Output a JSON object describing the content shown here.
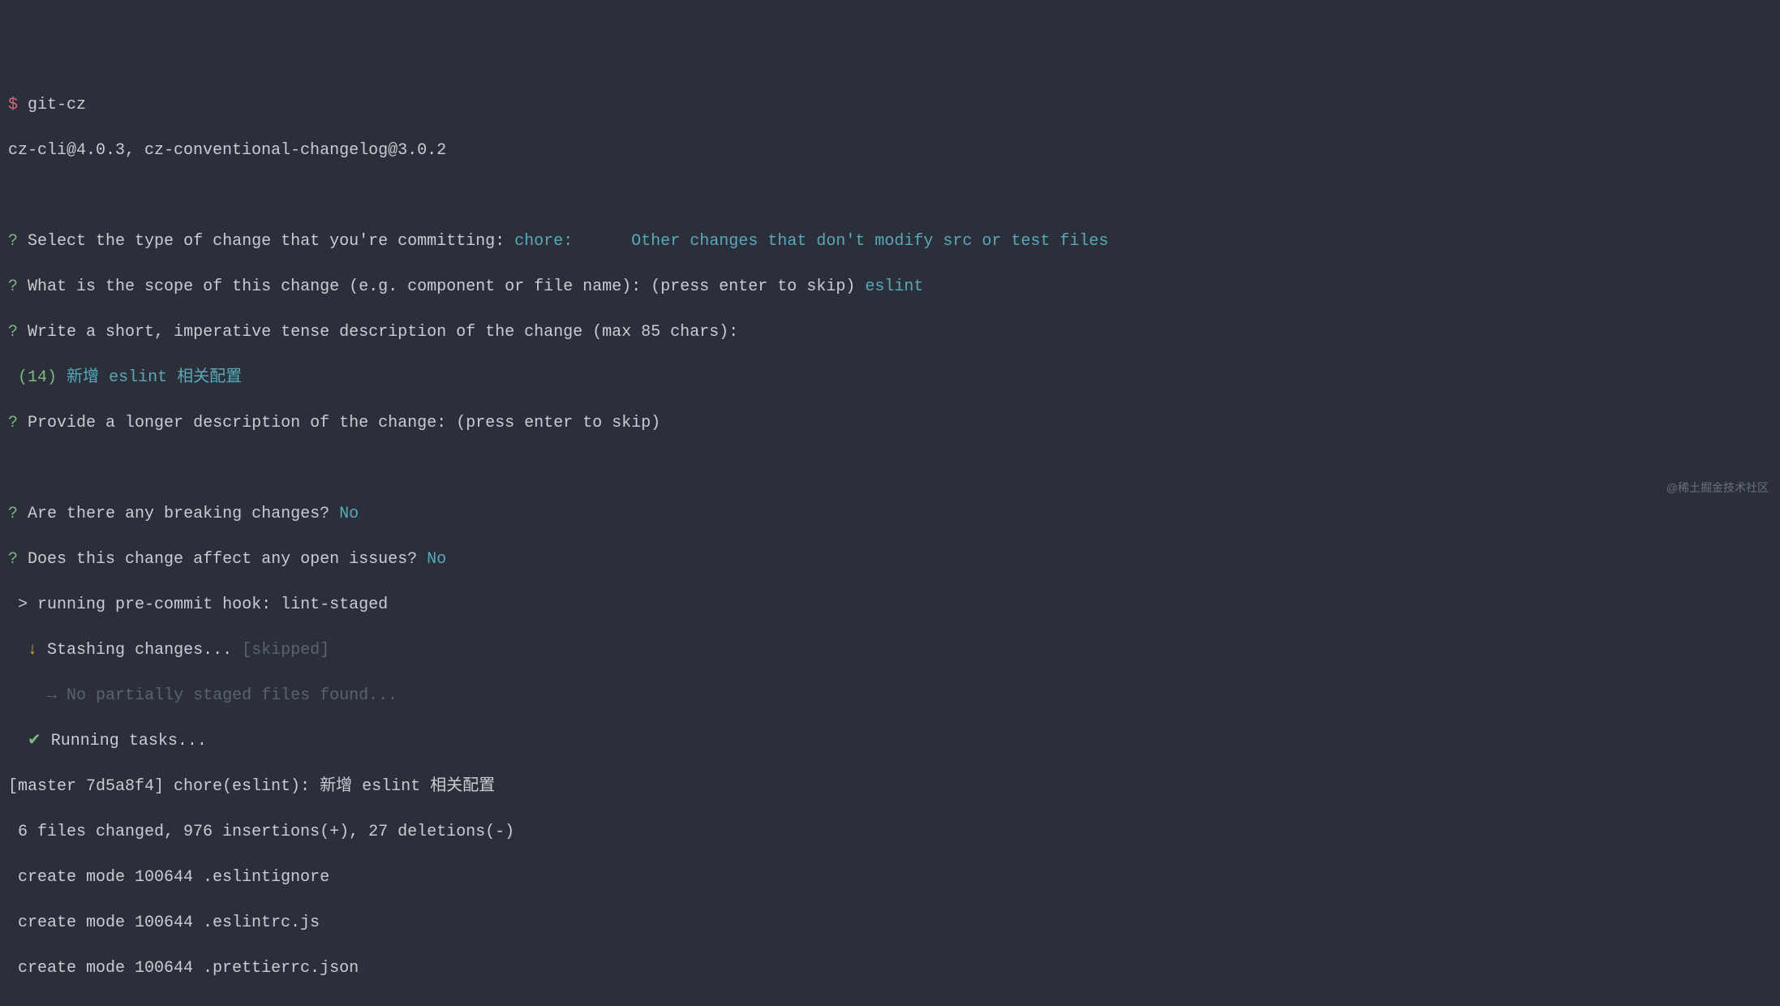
{
  "prompt": {
    "dollar": "$",
    "command": "git-cz"
  },
  "version": "cz-cli@4.0.3, cz-conventional-changelog@3.0.2",
  "q1": {
    "mark": "?",
    "text": "Select the type of change that you're committing:",
    "answer": "chore:      Other changes that don't modify src or test files"
  },
  "q2": {
    "mark": "?",
    "text": "What is the scope of this change (e.g. component or file name): (press enter to skip)",
    "answer": "eslint"
  },
  "q3": {
    "mark": "?",
    "text": "Write a short, imperative tense description of the change (max 85 chars):"
  },
  "desc": {
    "count": "(14)",
    "cjk1": "新增",
    "word": "eslint",
    "cjk2": "相关配置"
  },
  "q4": {
    "mark": "?",
    "text": "Provide a longer description of the change: (press enter to skip)"
  },
  "q5": {
    "mark": "?",
    "text": "Are there any breaking changes?",
    "answer": "No"
  },
  "q6": {
    "mark": "?",
    "text": "Does this change affect any open issues?",
    "answer": "No"
  },
  "hook": {
    "prefix": " >",
    "text": "running pre-commit hook: lint-staged"
  },
  "stash": {
    "arrow": "↓",
    "text": "Stashing changes...",
    "status": "[skipped]"
  },
  "partial": {
    "arrow": "→",
    "text": "No partially staged files found..."
  },
  "tasks": {
    "check": "✔",
    "text": "Running tasks..."
  },
  "commit": {
    "header": "[master 7d5a8f4] chore(eslint): 新增 eslint 相关配置",
    "stats": " 6 files changed, 976 insertions(+), 27 deletions(-)",
    "file1": " create mode 100644 .eslintignore",
    "file2": " create mode 100644 .eslintrc.js",
    "file3": " create mode 100644 .prettierrc.json"
  },
  "watermark": "@稀土掘金技术社区"
}
